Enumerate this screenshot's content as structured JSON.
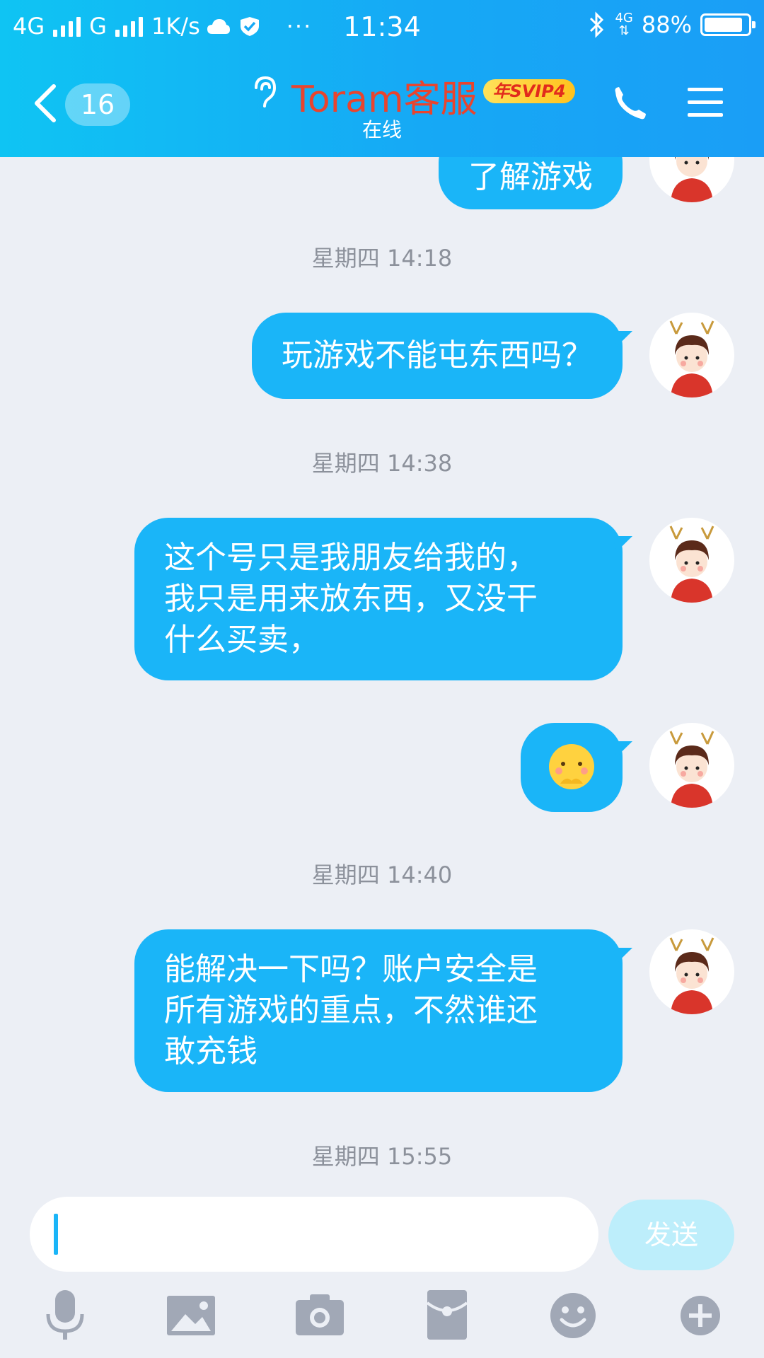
{
  "status_bar": {
    "network_1": "4G",
    "network_2": "G",
    "speed": "1K/s",
    "more": "···",
    "time": "11:34",
    "net_type": "4G",
    "battery": "88%",
    "battery_level": 0.88
  },
  "header": {
    "unread_count": "16",
    "title": "Toram客服",
    "svip_badge": "年SVIP4",
    "subtitle": "在线"
  },
  "messages": [
    {
      "text": "了解游戏"
    },
    {
      "timestamp": "星期四 14:18",
      "text": "玩游戏不能屯东西吗？"
    },
    {
      "timestamp": "星期四 14:38",
      "text": "这个号只是我朋友给我的，\n我只是用来放东西，又没干\n什么买卖，",
      "lines": [
        "这个号只是我朋友给我的，",
        "我只是用来放东西，又没干",
        "什么买卖，"
      ]
    },
    {
      "emoji": "shy-face"
    },
    {
      "timestamp": "星期四 14:40",
      "lines": [
        "能解决一下吗？账户安全是",
        "所有游戏的重点，不然谁还",
        "敢充钱"
      ]
    },
    {
      "timestamp": "星期四 15:55"
    }
  ],
  "input": {
    "send_label": "发送"
  },
  "toolbar": {
    "icons": [
      "microphone-icon",
      "image-icon",
      "camera-icon",
      "red-packet-icon",
      "emoji-icon",
      "plus-icon"
    ]
  },
  "colors": {
    "header_start": "#0fc4f3",
    "header_end": "#1a9ef6",
    "bubble": "#1ab5f8",
    "title": "#e9442e",
    "background": "#eceff5"
  }
}
